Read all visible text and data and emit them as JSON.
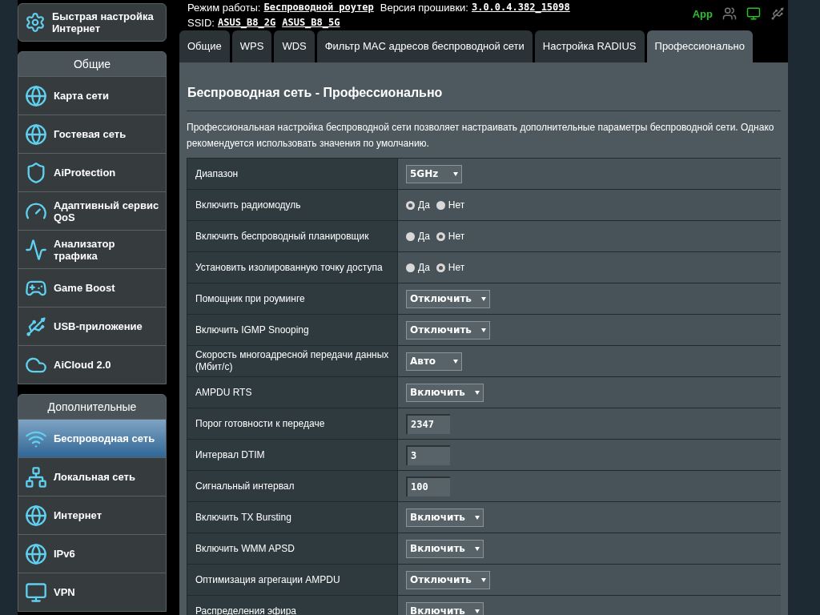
{
  "header": {
    "mode_label": "Режим работы:",
    "mode_value": "Беспроводной роутер",
    "firmware_label": "Версия прошивки:",
    "firmware_value": "3.0.0.4.382_15098",
    "ssid_label": "SSID:",
    "ssids": [
      "ASUS_B8_2G",
      "ASUS_B8_5G"
    ],
    "app": "App"
  },
  "quick_setup": "Быстрая настройка Интернет",
  "general": {
    "title": "Общие",
    "items": [
      {
        "label": "Карта сети",
        "selected": false
      },
      {
        "label": "Гостевая сеть",
        "selected": false
      },
      {
        "label": "AiProtection",
        "selected": false
      },
      {
        "label": "Адаптивный сервис QoS",
        "selected": false
      },
      {
        "label": "Анализатор трафика",
        "selected": false
      },
      {
        "label": "Game Boost",
        "selected": false
      },
      {
        "label": "USB-приложение",
        "selected": false
      },
      {
        "label": "AiCloud 2.0",
        "selected": false
      }
    ]
  },
  "advanced": {
    "title": "Дополнительные",
    "items": [
      {
        "label": "Беспроводная сеть",
        "selected": true
      },
      {
        "label": "Локальная сеть",
        "selected": false
      },
      {
        "label": "Интернет",
        "selected": false
      },
      {
        "label": "IPv6",
        "selected": false
      },
      {
        "label": "VPN",
        "selected": false
      }
    ]
  },
  "tabs": [
    {
      "label": "Общие",
      "selected": false
    },
    {
      "label": "WPS",
      "selected": false
    },
    {
      "label": "WDS",
      "selected": false
    },
    {
      "label": "Фильтр MAC адресов беспроводной сети",
      "selected": false
    },
    {
      "label": "Настройка RADIUS",
      "selected": false
    },
    {
      "label": "Профессионально",
      "selected": true
    }
  ],
  "title": "Беспроводная сеть - Профессионально",
  "description": "Профессиональная настройка беспроводной сети позволяет настраивать дополнительные параметры беспроводной сети. Однако рекомендуется использовать значения по умолчанию.",
  "settings": [
    {
      "kind": "select",
      "label": "Диапазон",
      "value": "5GHz"
    },
    {
      "kind": "radio",
      "label": "Включить радиомодуль",
      "options": [
        {
          "label": "Да",
          "selected": true
        },
        {
          "label": "Нет",
          "selected": false
        }
      ]
    },
    {
      "kind": "radio",
      "label": "Включить беспроводный планировщик",
      "options": [
        {
          "label": "Да",
          "selected": false
        },
        {
          "label": "Нет",
          "selected": true
        }
      ]
    },
    {
      "kind": "radio",
      "label": "Установить изолированную точку доступа",
      "options": [
        {
          "label": "Да",
          "selected": false
        },
        {
          "label": "Нет",
          "selected": true
        }
      ]
    },
    {
      "kind": "select",
      "label": "Помощник при роуминге",
      "value": "Отключить"
    },
    {
      "kind": "select",
      "label": "Включить IGMP Snooping",
      "value": "Отключить"
    },
    {
      "kind": "select",
      "label": "Скорость многоадресной передачи данных (Мбит/с)",
      "value": "Авто"
    },
    {
      "kind": "select",
      "label": "AMPDU RTS",
      "value": "Включить"
    },
    {
      "kind": "input",
      "label": "Порог готовности к передаче",
      "value": "2347"
    },
    {
      "kind": "input",
      "label": "Интервал DTIM",
      "value": "3"
    },
    {
      "kind": "input",
      "label": "Сигнальный интервал",
      "value": "100"
    },
    {
      "kind": "select",
      "label": "Включить TX Bursting",
      "value": "Включить"
    },
    {
      "kind": "select",
      "label": "Включить WMM APSD",
      "value": "Включить"
    },
    {
      "kind": "select",
      "label": "Оптимизация агрегации AMPDU",
      "value": "Отключить"
    },
    {
      "kind": "select",
      "label": "Распределения эфира",
      "value": "Включить"
    }
  ]
}
